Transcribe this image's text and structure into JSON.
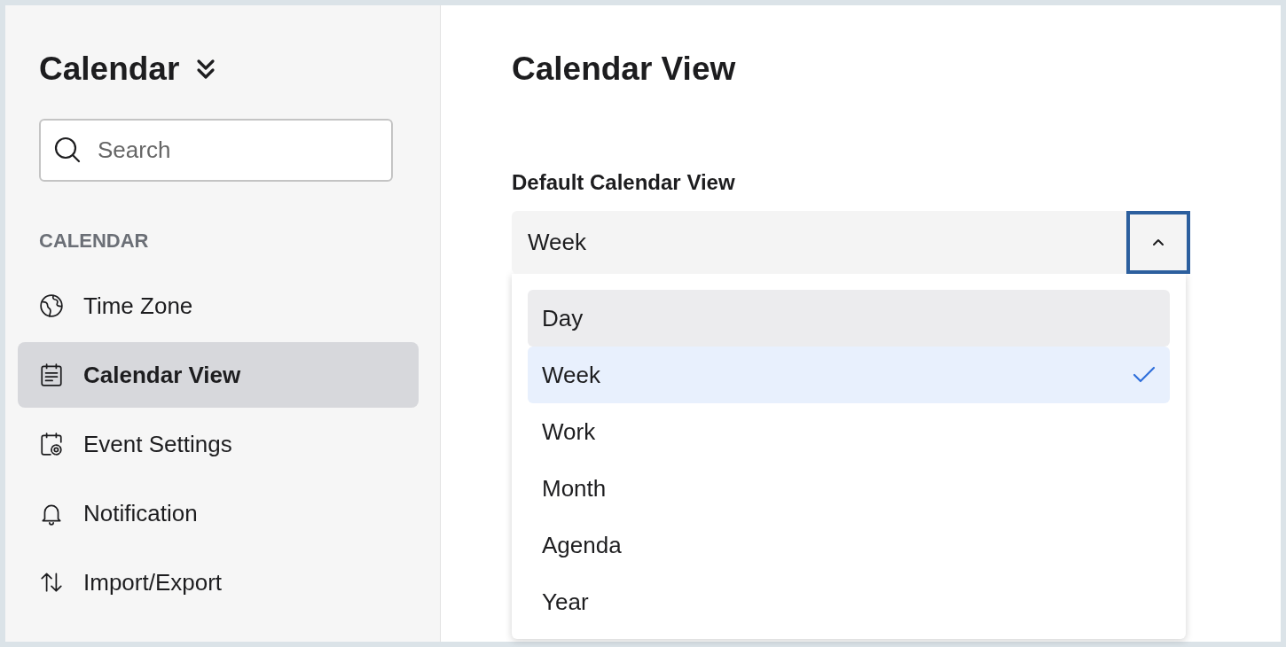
{
  "sidebar": {
    "title": "Calendar",
    "search": {
      "placeholder": "Search"
    },
    "section": "CALENDAR",
    "items": [
      {
        "label": "Time Zone",
        "selected": false
      },
      {
        "label": "Calendar View",
        "selected": true
      },
      {
        "label": "Event Settings",
        "selected": false
      },
      {
        "label": "Notification",
        "selected": false
      },
      {
        "label": "Import/Export",
        "selected": false
      }
    ]
  },
  "main": {
    "title": "Calendar View",
    "field_label": "Default Calendar View",
    "select": {
      "value": "Week",
      "expanded": true,
      "options": [
        {
          "label": "Day",
          "hovered": true,
          "selected": false
        },
        {
          "label": "Week",
          "hovered": false,
          "selected": true
        },
        {
          "label": "Work",
          "hovered": false,
          "selected": false
        },
        {
          "label": "Month",
          "hovered": false,
          "selected": false
        },
        {
          "label": "Agenda",
          "hovered": false,
          "selected": false
        },
        {
          "label": "Year",
          "hovered": false,
          "selected": false
        }
      ]
    }
  }
}
